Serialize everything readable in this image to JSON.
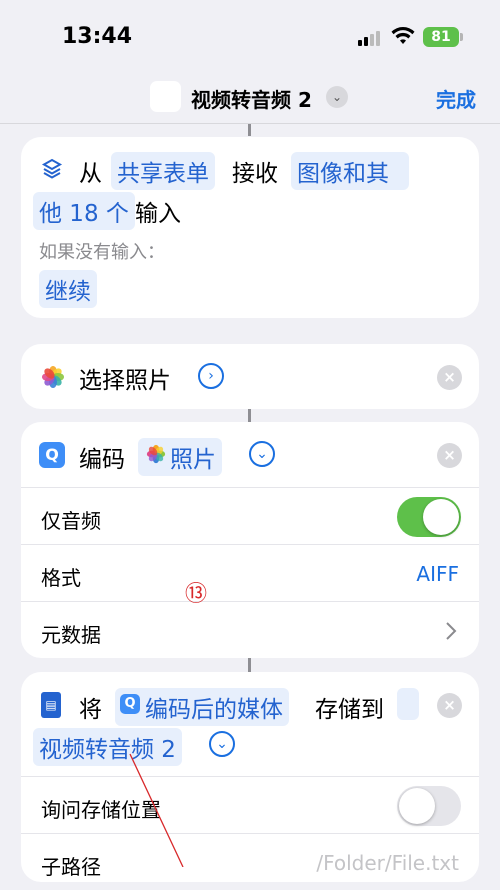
{
  "status": {
    "time": "13:44",
    "battery": "81"
  },
  "navbar": {
    "title": "视频转音频 2",
    "done": "完成"
  },
  "receive_card": {
    "from": "从",
    "source": "共享表单",
    "receive": "接收",
    "types_part1": "图像和其",
    "types_part2": "他 18 个",
    "input": "输入",
    "if_no_input": "如果没有输入：",
    "continue": "继续"
  },
  "select_photos": {
    "label": "选择照片"
  },
  "encode": {
    "title": "编码",
    "token": "照片",
    "audio_only": "仅音频",
    "audio_only_on": true,
    "format_label": "格式",
    "format_value": "AIFF",
    "metadata_label": "元数据"
  },
  "save": {
    "will": "将",
    "token": "编码后的媒体",
    "save_to": "存储到",
    "target": "视频转音频 2",
    "ask_location": "询问存储位置",
    "ask_location_on": false,
    "subpath_label": "子路径",
    "subpath_placeholder": "/Folder/File.txt"
  },
  "annotation": {
    "number": "⑬"
  },
  "colors": {
    "accent": "#1a6fe0",
    "toggle_on": "#5ec04a",
    "toggle_off": "#e5e5ea",
    "annotation": "#d8282a"
  }
}
